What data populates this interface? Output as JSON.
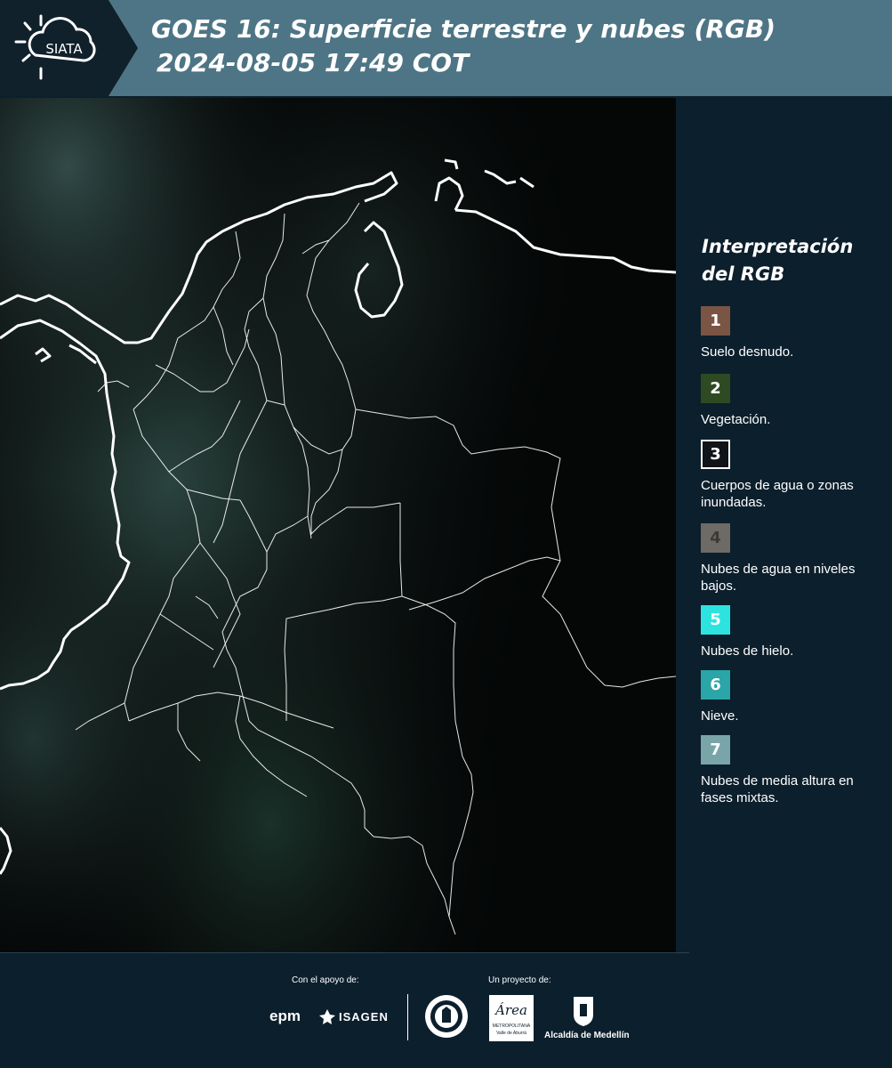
{
  "header": {
    "logo_text": "SIATA",
    "title_line1": "GOES 16: Superficie terrestre y nubes (RGB)",
    "title_line2": "2024-08-05 17:49 COT"
  },
  "legend": {
    "title": "Interpretación del RGB",
    "items": [
      {
        "number": "1",
        "label": "Suelo desnudo.",
        "color": "#7a5544"
      },
      {
        "number": "2",
        "label": "Vegetación.",
        "color": "#2e4a22"
      },
      {
        "number": "3",
        "label": "Cuerpos de agua o zonas inundadas.",
        "color": "#111418"
      },
      {
        "number": "4",
        "label": "Nubes de agua en niveles bajos.",
        "color": "#6e6a66"
      },
      {
        "number": "5",
        "label": "Nubes de hielo.",
        "color": "#2de3e0"
      },
      {
        "number": "6",
        "label": "Nieve.",
        "color": "#2aa5a8"
      },
      {
        "number": "7",
        "label": "Nubes de media altura en fases mixtas.",
        "color": "#7aa5a8"
      }
    ]
  },
  "footer": {
    "support_label": "Con el apoyo de:",
    "project_label": "Un proyecto de:",
    "sponsor_epm": "epm",
    "sponsor_isagen": "ISAGEN",
    "area_logo_text": "Área",
    "area_sub1": "METROPOLITANA",
    "area_sub2": "Valle de Aburrá",
    "alcaldia_text": "Alcaldía de Medellín"
  },
  "colors": {
    "header_bg": "#4d7585",
    "panel_bg": "#0c1f2c",
    "map_bg": "#040606"
  }
}
